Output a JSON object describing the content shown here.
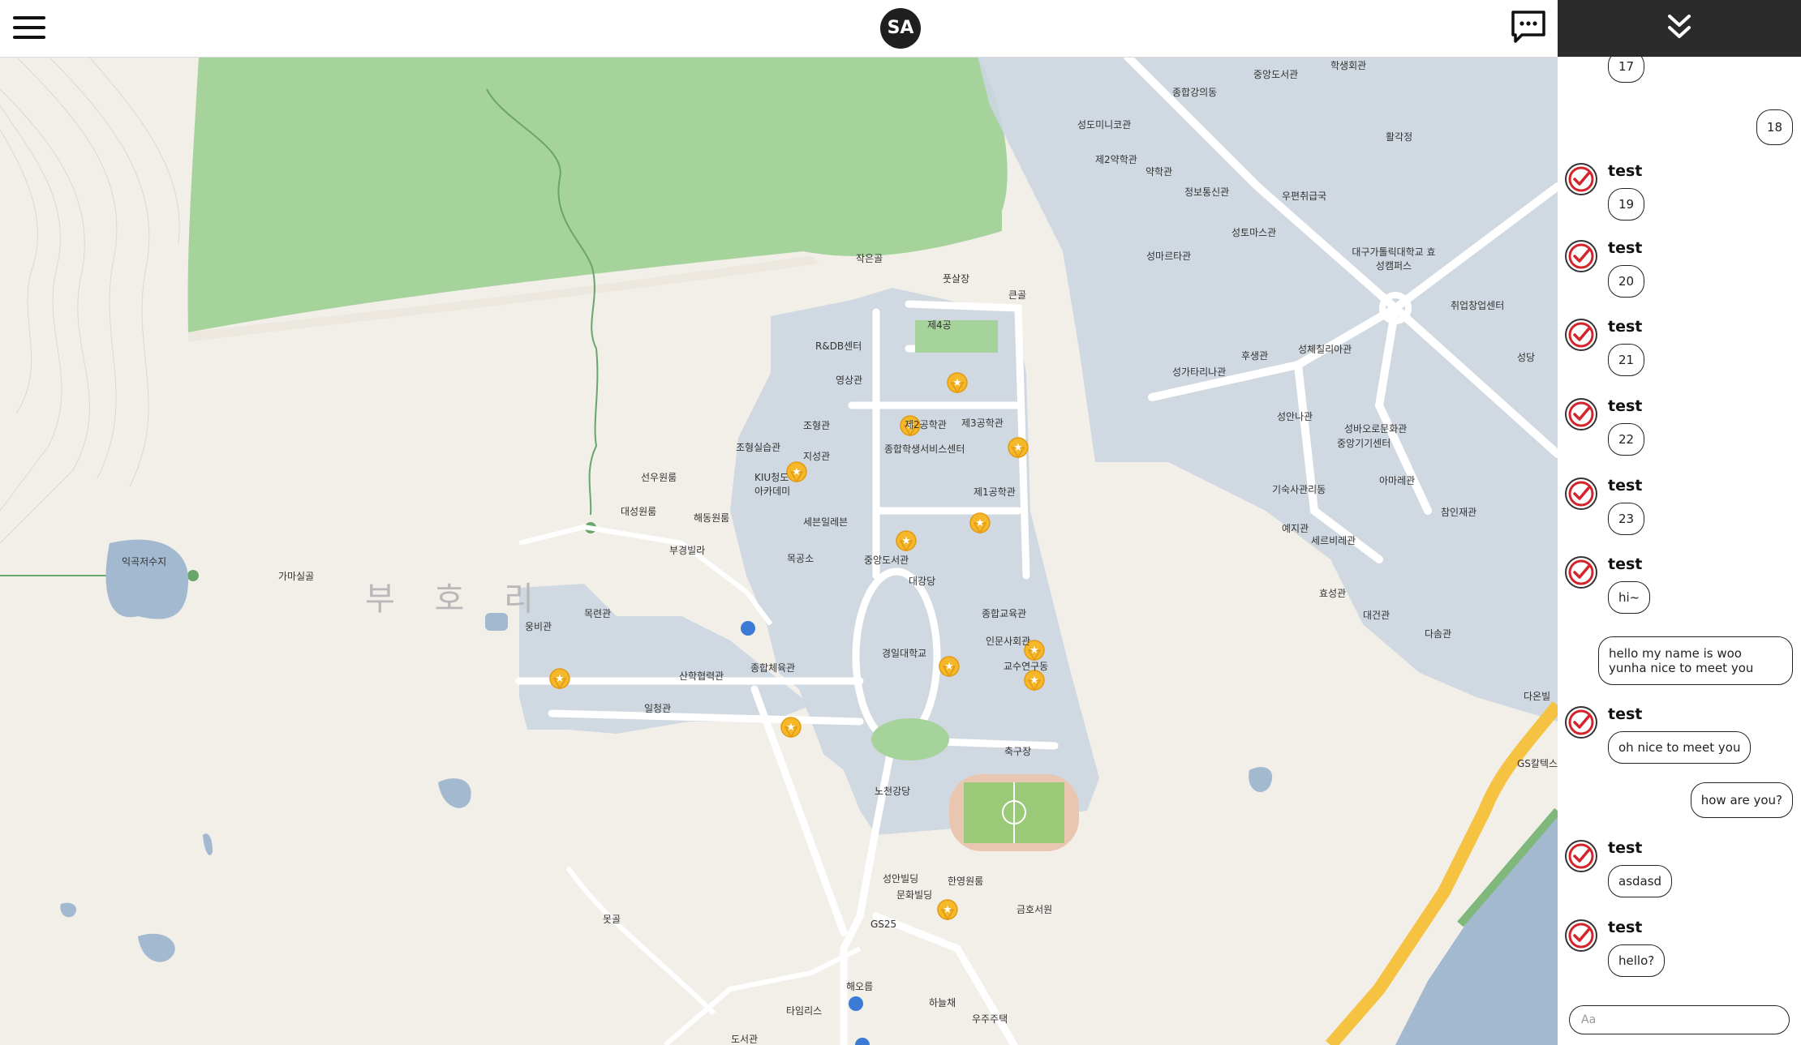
{
  "header": {
    "logo_text": "SA",
    "menu_icon": "hamburger-menu-icon",
    "chat_icon": "chat-bubble-icon"
  },
  "map": {
    "area_label": "부 호 리",
    "labels": [
      "작은골",
      "풋살장",
      "큰골",
      "제4공",
      "R&DB센터",
      "영상관",
      "조형관",
      "제2공학관",
      "제3공학관",
      "종합학생서비스센터",
      "조형실습관",
      "지성관",
      "제1공학관",
      "KIU청도 아카데미",
      "선우원룸",
      "대성원룸",
      "해동원룸",
      "세븐일레븐",
      "부경빌라",
      "목공소",
      "중앙도서관",
      "대강당",
      "종합교육관",
      "인문사회관",
      "교수연구동",
      "경일대학교",
      "목련관",
      "웅비관",
      "종합체육관",
      "산학협력관",
      "일청관",
      "축구장",
      "노천강당",
      "성안빌딩",
      "한영원룸",
      "문화빌딩",
      "GS25",
      "금호서원",
      "해오름",
      "하늘채",
      "타임리스",
      "우주주택",
      "도서관",
      "익곡저수지",
      "가마실골",
      "못골",
      "종합강의동",
      "중앙도서관",
      "학생회관",
      "성도미니코관",
      "제2약학관",
      "약학관",
      "정보통신관",
      "우편취급국",
      "활각정",
      "성토마스관",
      "대구가톨릭대학교 효성캠퍼스",
      "성마르타관",
      "취업창업센터",
      "성가타리나관",
      "후생관",
      "성체칠리아관",
      "성당",
      "성안나관",
      "성바오로문화관",
      "중앙기기센터",
      "아마레관",
      "기숙사관리동",
      "참인재관",
      "예지관",
      "세르비레관",
      "효성관",
      "대건관",
      "다솜관",
      "다온빌",
      "GS칼텍스"
    ],
    "pin_icon": "star-map-pin-icon"
  },
  "chat": {
    "collapse_icon": "double-chevron-down-icon",
    "input_placeholder": "Aa",
    "messages": [
      {
        "from": "test",
        "text": "17",
        "side": "left"
      },
      {
        "from": "me",
        "text": "18",
        "side": "right"
      },
      {
        "from": "test",
        "text": "19",
        "side": "left"
      },
      {
        "from": "test",
        "text": "20",
        "side": "left"
      },
      {
        "from": "test",
        "text": "21",
        "side": "left"
      },
      {
        "from": "test",
        "text": "22",
        "side": "left"
      },
      {
        "from": "test",
        "text": "23",
        "side": "left"
      },
      {
        "from": "test",
        "text": "hi~",
        "side": "left"
      },
      {
        "from": "me",
        "text": "hello my name is woo yunha nice to meet you",
        "side": "right"
      },
      {
        "from": "test",
        "text": "oh nice to meet you",
        "side": "left"
      },
      {
        "from": "me",
        "text": "how are you?",
        "side": "right"
      },
      {
        "from": "test",
        "text": "asdasd",
        "side": "left"
      },
      {
        "from": "test",
        "text": "hello?",
        "side": "left"
      }
    ]
  }
}
